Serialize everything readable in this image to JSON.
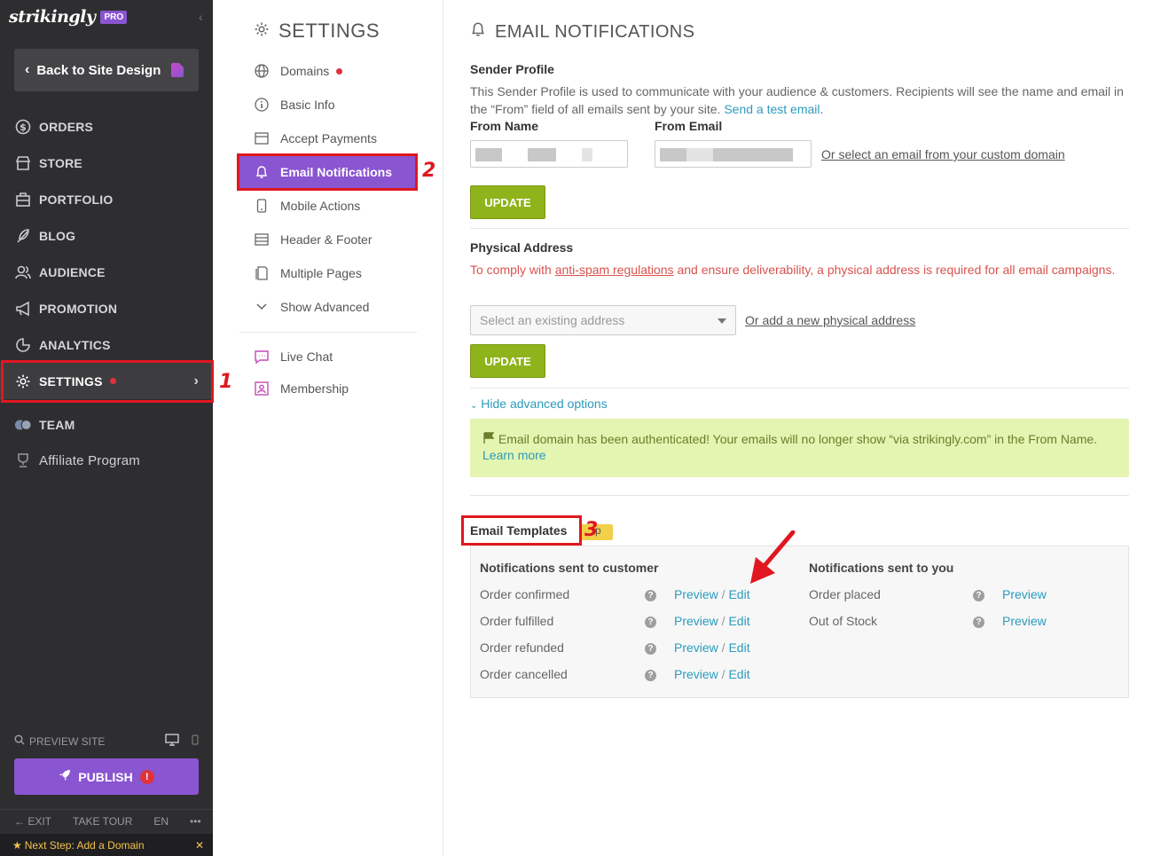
{
  "sidebar": {
    "logo": "strikingly",
    "pro_badge": "PRO",
    "back_label": "Back to Site Design",
    "items": [
      {
        "label": "ORDERS"
      },
      {
        "label": "STORE"
      },
      {
        "label": "PORTFOLIO"
      },
      {
        "label": "BLOG"
      },
      {
        "label": "AUDIENCE"
      },
      {
        "label": "PROMOTION"
      },
      {
        "label": "ANALYTICS"
      },
      {
        "label": "SETTINGS"
      }
    ],
    "team_label": "TEAM",
    "affiliate_label": "Affiliate Program",
    "preview_label": "PREVIEW SITE",
    "publish_label": "PUBLISH",
    "publish_warn": "!",
    "footer": {
      "exit": "EXIT",
      "tour": "TAKE TOUR",
      "lang": "EN",
      "more": "•••"
    },
    "next_step": "Next Step: Add a Domain",
    "next_close": "✕"
  },
  "annotations": {
    "n1": "1",
    "n2": "2",
    "n3": "3"
  },
  "subnav": {
    "title": "SETTINGS",
    "items": [
      {
        "label": "Domains"
      },
      {
        "label": "Basic Info"
      },
      {
        "label": "Accept Payments"
      },
      {
        "label": "Email Notifications"
      },
      {
        "label": "Mobile Actions"
      },
      {
        "label": "Header & Footer"
      },
      {
        "label": "Multiple Pages"
      },
      {
        "label": "Show Advanced"
      },
      {
        "label": "Live Chat"
      },
      {
        "label": "Membership"
      }
    ]
  },
  "main": {
    "title": "EMAIL NOTIFICATIONS",
    "sender": {
      "heading": "Sender Profile",
      "desc": "This Sender Profile is used to communicate with your audience & customers. Recipients will see the name and email in the “From” field of all emails sent by your site.",
      "test_link": "Send a test email",
      "desc_end": ".",
      "from_name_label": "From Name",
      "from_email_label": "From Email",
      "custom_domain_link": "Or select an email from your custom domain",
      "update": "UPDATE"
    },
    "address": {
      "heading": "Physical Address",
      "warn_pre": "To comply with ",
      "warn_link": "anti-spam regulations",
      "warn_post": " and ensure deliverability, a physical address is required for all email campaigns.",
      "select_placeholder": "Select an existing address",
      "add_link": "Or add a new physical address",
      "update": "UPDATE"
    },
    "advanced_toggle": "Hide advanced options",
    "success": {
      "text": "Email domain has been authenticated! Your emails will no longer show “via strikingly.com” in the From Name.",
      "link": "Learn more"
    },
    "templates": {
      "title": "Email Templates",
      "tag": "p",
      "customer_heading": "Notifications sent to customer",
      "you_heading": "Notifications sent to you",
      "customer_rows": [
        {
          "label": "Order confirmed"
        },
        {
          "label": "Order fulfilled"
        },
        {
          "label": "Order refunded"
        },
        {
          "label": "Order cancelled"
        }
      ],
      "you_rows": [
        {
          "label": "Order placed"
        },
        {
          "label": "Out of Stock"
        }
      ],
      "preview": "Preview",
      "slash": " / ",
      "edit": "Edit",
      "help": "?"
    }
  },
  "colors": {
    "sidebar_bg": "#2e2e30",
    "accent_purple": "#8a55d0",
    "update_green": "#8fb31a",
    "link_blue": "#2b9bbd",
    "annotation_red": "#e0171f",
    "success_bg": "#e4f4b1"
  }
}
